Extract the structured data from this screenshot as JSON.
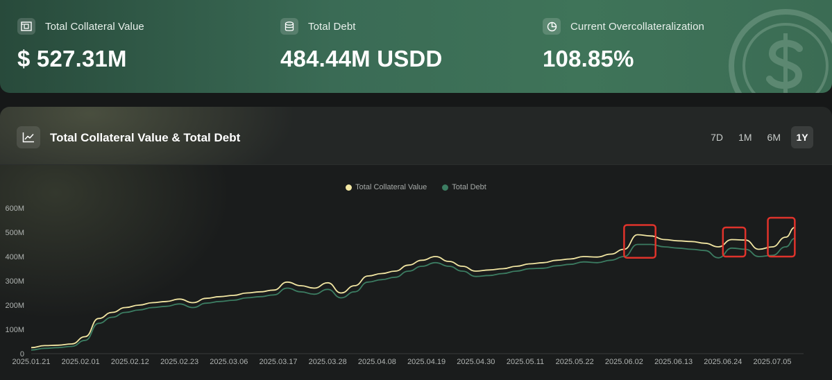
{
  "stats": [
    {
      "label": "Total Collateral Value",
      "value": "$ 527.31M",
      "icon": "collateral-icon"
    },
    {
      "label": "Total Debt",
      "value": "484.44M USDD",
      "icon": "database-icon"
    },
    {
      "label": "Current Overcollateralization",
      "value": "108.85%",
      "icon": "pie-chart-icon"
    }
  ],
  "chart_card": {
    "title": "Total Collateral Value & Total Debt",
    "ranges": [
      {
        "label": "7D",
        "active": false
      },
      {
        "label": "1M",
        "active": false
      },
      {
        "label": "6M",
        "active": false
      },
      {
        "label": "1Y",
        "active": true
      }
    ]
  },
  "colors": {
    "collateral": "#f3e7a3",
    "debt": "#3c7d62",
    "highlight_box": "#e0332b",
    "accent_green": "#3f7459"
  },
  "chart_data": {
    "type": "line",
    "title": "",
    "xlabel": "",
    "ylabel": "",
    "legend_position": "top-center",
    "ylim": [
      0,
      600
    ],
    "y_unit": "M",
    "y_ticks": [
      "0",
      "100M",
      "200M",
      "300M",
      "400M",
      "500M",
      "600M"
    ],
    "x_ticks": [
      "2025.01.21",
      "2025.02.01",
      "2025.02.12",
      "2025.02.23",
      "2025.03.06",
      "2025.03.17",
      "2025.03.28",
      "2025.04.08",
      "2025.04.19",
      "2025.04.30",
      "2025.05.11",
      "2025.05.22",
      "2025.06.02",
      "2025.06.13",
      "2025.06.24",
      "2025.07.05"
    ],
    "x": [
      "2025-01-21",
      "2025-01-24",
      "2025-01-27",
      "2025-01-30",
      "2025-02-02",
      "2025-02-05",
      "2025-02-08",
      "2025-02-11",
      "2025-02-14",
      "2025-02-17",
      "2025-02-20",
      "2025-02-23",
      "2025-02-26",
      "2025-03-01",
      "2025-03-04",
      "2025-03-07",
      "2025-03-10",
      "2025-03-13",
      "2025-03-16",
      "2025-03-19",
      "2025-03-22",
      "2025-03-25",
      "2025-03-28",
      "2025-03-31",
      "2025-04-03",
      "2025-04-06",
      "2025-04-09",
      "2025-04-12",
      "2025-04-15",
      "2025-04-18",
      "2025-04-21",
      "2025-04-24",
      "2025-04-27",
      "2025-04-30",
      "2025-05-03",
      "2025-05-06",
      "2025-05-09",
      "2025-05-12",
      "2025-05-15",
      "2025-05-18",
      "2025-05-21",
      "2025-05-24",
      "2025-05-27",
      "2025-05-30",
      "2025-06-02",
      "2025-06-05",
      "2025-06-08",
      "2025-06-11",
      "2025-06-14",
      "2025-06-17",
      "2025-06-20",
      "2025-06-23",
      "2025-06-26",
      "2025-06-29",
      "2025-07-02",
      "2025-07-05",
      "2025-07-08",
      "2025-07-10"
    ],
    "series": [
      {
        "name": "Total Collateral Value",
        "color": "#f3e7a3",
        "values": [
          25,
          33,
          35,
          40,
          70,
          145,
          170,
          190,
          200,
          210,
          215,
          225,
          210,
          228,
          235,
          240,
          250,
          255,
          262,
          295,
          280,
          270,
          292,
          250,
          280,
          320,
          330,
          340,
          365,
          385,
          400,
          380,
          360,
          340,
          345,
          350,
          360,
          370,
          375,
          385,
          390,
          400,
          398,
          410,
          430,
          490,
          485,
          470,
          465,
          462,
          455,
          440,
          470,
          468,
          430,
          440,
          480,
          520
        ]
      },
      {
        "name": "Total Debt",
        "color": "#3c7d62",
        "values": [
          15,
          22,
          25,
          30,
          55,
          125,
          150,
          170,
          180,
          190,
          195,
          205,
          190,
          208,
          215,
          220,
          230,
          235,
          242,
          270,
          255,
          245,
          265,
          230,
          255,
          295,
          305,
          315,
          340,
          360,
          375,
          360,
          340,
          318,
          322,
          330,
          340,
          350,
          352,
          362,
          368,
          378,
          375,
          385,
          400,
          450,
          450,
          440,
          435,
          430,
          425,
          395,
          435,
          430,
          400,
          405,
          440,
          475
        ]
      }
    ],
    "highlights": [
      {
        "x_from": "2025-06-02",
        "x_to": "2025-06-09",
        "y_from": 395,
        "y_to": 530
      },
      {
        "x_from": "2025-06-24",
        "x_to": "2025-06-29",
        "y_from": 400,
        "y_to": 520
      },
      {
        "x_from": "2025-07-04",
        "x_to": "2025-07-10",
        "y_from": 400,
        "y_to": 560
      }
    ]
  }
}
